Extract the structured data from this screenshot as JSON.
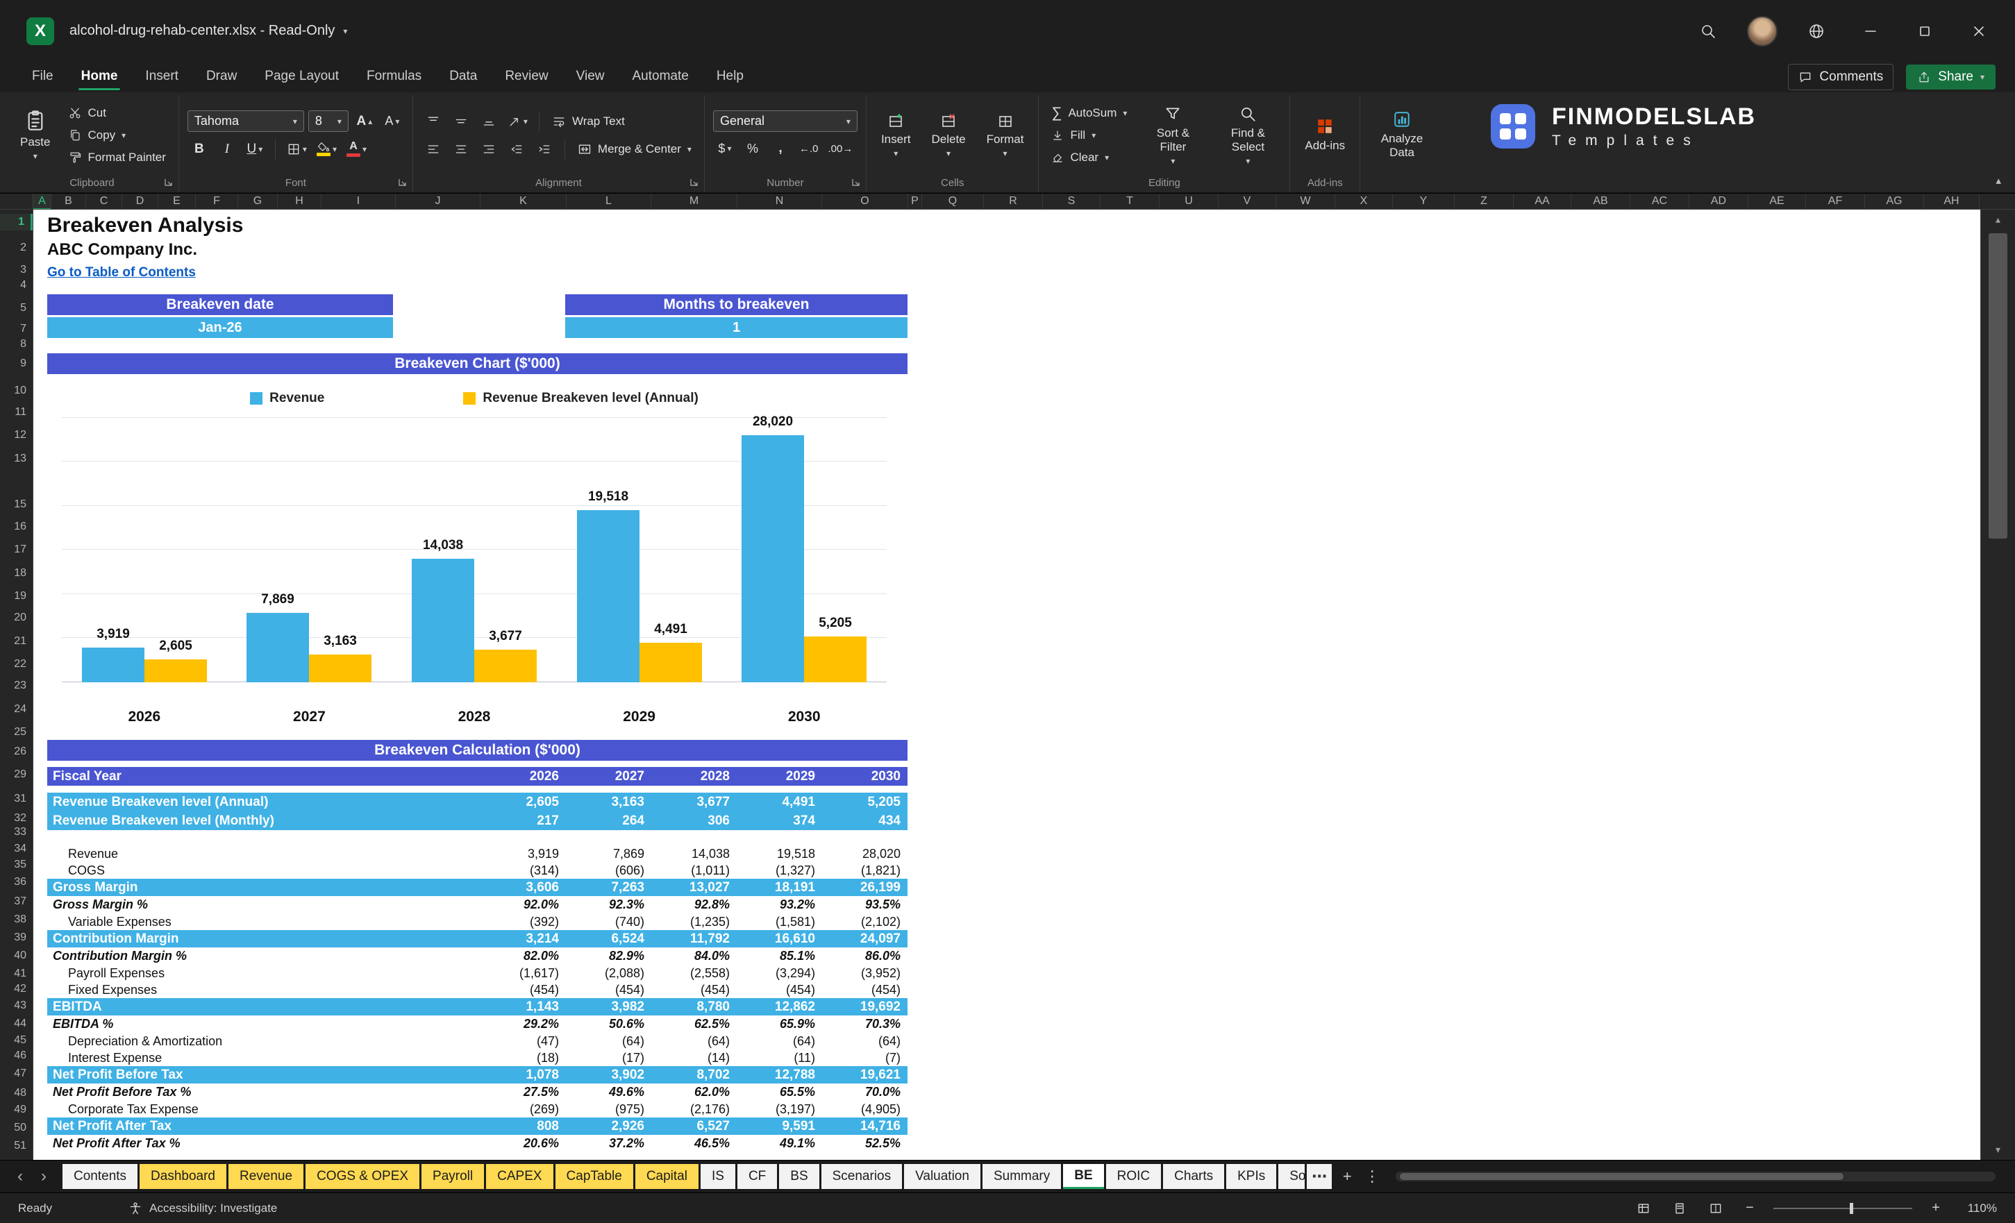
{
  "window": {
    "app_icon": "X",
    "title": "alcohol-drug-rehab-center.xlsx  -  Read-Only"
  },
  "icons": {
    "chevron_down": "▾",
    "chevron_up": "▴",
    "nav_left": "‹",
    "nav_right": "›",
    "ellipsis_h": "⋯",
    "ellipsis_v": "⋮",
    "plus": "+",
    "minus": "−",
    "sum": "∑"
  },
  "menu": {
    "tabs": [
      "File",
      "Home",
      "Insert",
      "Draw",
      "Page Layout",
      "Formulas",
      "Data",
      "Review",
      "View",
      "Automate",
      "Help"
    ],
    "active": "Home",
    "comments_label": "Comments",
    "share_label": "Share"
  },
  "ribbon": {
    "clipboard": {
      "label": "Clipboard",
      "paste": "Paste",
      "cut": "Cut",
      "copy": "Copy",
      "format_painter": "Format Painter"
    },
    "font": {
      "label": "Font",
      "name": "Tahoma",
      "size": "8",
      "letter": "A",
      "bold": "B",
      "italic": "I",
      "underline": "U"
    },
    "alignment": {
      "label": "Alignment",
      "wrap": "Wrap Text",
      "merge": "Merge & Center"
    },
    "number": {
      "label": "Number",
      "format": "General",
      "currency": "$",
      "percent": "%",
      "comma": ",",
      "inc_decimal": "←.0",
      "dec_decimal": ".00→"
    },
    "cells": {
      "label": "Cells",
      "insert": "Insert",
      "delete": "Delete",
      "format": "Format"
    },
    "editing": {
      "label": "Editing",
      "autosum": "AutoSum",
      "fill": "Fill",
      "clear": "Clear",
      "sort_filter": "Sort & Filter",
      "find_select": "Find & Select"
    },
    "addins": {
      "label": "Add-ins",
      "button": "Add-ins",
      "analyze": "Analyze Data"
    },
    "brand": {
      "line1": "FINMODELSLAB",
      "line2": "Templates"
    }
  },
  "grid": {
    "columns": [
      "A",
      "B",
      "C",
      "D",
      "E",
      "F",
      "G",
      "H",
      "I",
      "J",
      "K",
      "L",
      "M",
      "N",
      "O",
      "P",
      "Q",
      "R",
      "S",
      "T",
      "U",
      "V",
      "W",
      "X",
      "Y",
      "Z",
      "AA",
      "AB",
      "AC",
      "AD",
      "AE",
      "AF",
      "AG",
      "AH"
    ],
    "rows": [
      "1",
      "2",
      "3",
      "4",
      "5",
      "7",
      "8",
      "9",
      "10",
      "11",
      "12",
      "13",
      "15",
      "16",
      "17",
      "18",
      "19",
      "20",
      "21",
      "22",
      "23",
      "24",
      "25",
      "26",
      "29",
      "31",
      "32",
      "33",
      "34",
      "35",
      "36",
      "37",
      "38",
      "39",
      "40",
      "41",
      "42",
      "43",
      "44",
      "45",
      "46",
      "47",
      "48",
      "49",
      "50",
      "51"
    ],
    "selected_column": "A",
    "selected_row": "1"
  },
  "sheet": {
    "title": "Breakeven Analysis",
    "company": "ABC Company Inc.",
    "link": "Go to Table of Contents",
    "breakeven_date_label": "Breakeven date",
    "breakeven_date_value": "Jan-26",
    "months_label": "Months to breakeven",
    "months_value": "1",
    "chart_header": "Breakeven Chart ($'000)",
    "calc_header": "Breakeven Calculation ($'000)"
  },
  "chart_data": {
    "type": "bar",
    "title": "Breakeven Chart ($'000)",
    "categories": [
      "2026",
      "2027",
      "2028",
      "2029",
      "2030"
    ],
    "series": [
      {
        "name": "Revenue",
        "color": "#3fb1e5",
        "values": [
          3919,
          7869,
          14038,
          19518,
          28020
        ]
      },
      {
        "name": "Revenue Breakeven level (Annual)",
        "color": "#ffc000",
        "values": [
          2605,
          3163,
          3677,
          4491,
          5205
        ]
      }
    ],
    "ylim": [
      0,
      30000
    ],
    "gridline_step": 5000,
    "grid": "horizontal-lines",
    "legend_position": "top",
    "data_labels": true,
    "xlabel": "",
    "ylabel": ""
  },
  "table": {
    "columns": [
      "Fiscal Year",
      "2026",
      "2027",
      "2028",
      "2029",
      "2030"
    ],
    "rows": [
      {
        "kind": "gap-sm"
      },
      {
        "kind": "highlight",
        "label": "Revenue Breakeven level (Annual)",
        "values": [
          "2,605",
          "3,163",
          "3,677",
          "4,491",
          "5,205"
        ]
      },
      {
        "kind": "highlight",
        "label": "Revenue Breakeven level (Monthly)",
        "values": [
          "217",
          "264",
          "306",
          "374",
          "434"
        ]
      },
      {
        "kind": "gap"
      },
      {
        "kind": "plain",
        "label": "Revenue",
        "values": [
          "3,919",
          "7,869",
          "14,038",
          "19,518",
          "28,020"
        ]
      },
      {
        "kind": "plain",
        "label": "COGS",
        "values": [
          "(314)",
          "(606)",
          "(1,011)",
          "(1,327)",
          "(1,821)"
        ]
      },
      {
        "kind": "band",
        "label": "Gross Margin",
        "values": [
          "3,606",
          "7,263",
          "13,027",
          "18,191",
          "26,199"
        ]
      },
      {
        "kind": "pct",
        "label": "Gross Margin %",
        "values": [
          "92.0%",
          "92.3%",
          "92.8%",
          "93.2%",
          "93.5%"
        ]
      },
      {
        "kind": "plain",
        "label": "Variable Expenses",
        "values": [
          "(392)",
          "(740)",
          "(1,235)",
          "(1,581)",
          "(2,102)"
        ]
      },
      {
        "kind": "band",
        "label": "Contribution Margin",
        "values": [
          "3,214",
          "6,524",
          "11,792",
          "16,610",
          "24,097"
        ]
      },
      {
        "kind": "pct",
        "label": "Contribution Margin %",
        "values": [
          "82.0%",
          "82.9%",
          "84.0%",
          "85.1%",
          "86.0%"
        ]
      },
      {
        "kind": "plain",
        "label": "Payroll Expenses",
        "values": [
          "(1,617)",
          "(2,088)",
          "(2,558)",
          "(3,294)",
          "(3,952)"
        ]
      },
      {
        "kind": "plain",
        "label": "Fixed Expenses",
        "values": [
          "(454)",
          "(454)",
          "(454)",
          "(454)",
          "(454)"
        ]
      },
      {
        "kind": "band",
        "label": "EBITDA",
        "values": [
          "1,143",
          "3,982",
          "8,780",
          "12,862",
          "19,692"
        ]
      },
      {
        "kind": "pct",
        "label": "EBITDA %",
        "values": [
          "29.2%",
          "50.6%",
          "62.5%",
          "65.9%",
          "70.3%"
        ]
      },
      {
        "kind": "plain",
        "label": "Depreciation & Amortization",
        "values": [
          "(47)",
          "(64)",
          "(64)",
          "(64)",
          "(64)"
        ]
      },
      {
        "kind": "plain",
        "label": "Interest Expense",
        "values": [
          "(18)",
          "(17)",
          "(14)",
          "(11)",
          "(7)"
        ]
      },
      {
        "kind": "band",
        "label": "Net Profit Before Tax",
        "values": [
          "1,078",
          "3,902",
          "8,702",
          "12,788",
          "19,621"
        ]
      },
      {
        "kind": "pct",
        "label": "Net Profit Before Tax %",
        "values": [
          "27.5%",
          "49.6%",
          "62.0%",
          "65.5%",
          "70.0%"
        ]
      },
      {
        "kind": "plain",
        "label": "Corporate Tax Expense",
        "values": [
          "(269)",
          "(975)",
          "(2,176)",
          "(3,197)",
          "(4,905)"
        ]
      },
      {
        "kind": "band",
        "label": "Net Profit After Tax",
        "values": [
          "808",
          "2,926",
          "6,527",
          "9,591",
          "14,716"
        ]
      },
      {
        "kind": "pct",
        "label": "Net Profit After Tax %",
        "values": [
          "20.6%",
          "37.2%",
          "46.5%",
          "49.1%",
          "52.5%"
        ]
      }
    ]
  },
  "sheet_tabs": {
    "tabs": [
      {
        "label": "Contents",
        "color": "white"
      },
      {
        "label": "Dashboard",
        "color": "yellow"
      },
      {
        "label": "Revenue",
        "color": "yellow"
      },
      {
        "label": "COGS & OPEX",
        "color": "yellow"
      },
      {
        "label": "Payroll",
        "color": "yellow"
      },
      {
        "label": "CAPEX",
        "color": "yellow"
      },
      {
        "label": "CapTable",
        "color": "yellow"
      },
      {
        "label": "Capital",
        "color": "yellow"
      },
      {
        "label": "IS",
        "color": "white"
      },
      {
        "label": "CF",
        "color": "white"
      },
      {
        "label": "BS",
        "color": "white"
      },
      {
        "label": "Scenarios",
        "color": "white"
      },
      {
        "label": "Valuation",
        "color": "white"
      },
      {
        "label": "Summary",
        "color": "white"
      },
      {
        "label": "BE",
        "color": "white",
        "active": true
      },
      {
        "label": "ROIC",
        "color": "white"
      },
      {
        "label": "Charts",
        "color": "white"
      },
      {
        "label": "KPIs",
        "color": "white"
      },
      {
        "label": "So",
        "color": "white",
        "truncated": true
      }
    ]
  },
  "status": {
    "ready": "Ready",
    "accessibility": "Accessibility: Investigate",
    "zoom_level": "110%"
  },
  "colors": {
    "header_bar": "#4a55d2",
    "band": "#3fb1e5",
    "chart_revenue": "#3fb1e5",
    "chart_breakeven": "#ffc000",
    "tab_yellow": "#ffd951",
    "accent_green": "#21a366",
    "link": "#0a5bc4"
  }
}
